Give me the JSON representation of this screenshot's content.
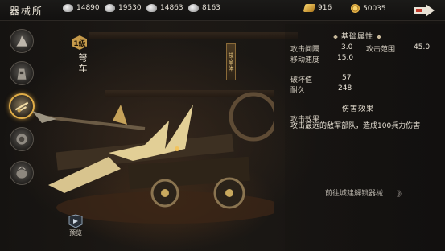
{
  "header": {
    "title": "器械所",
    "resources": [
      {
        "icon": "silver-ore-icon",
        "value": "14890"
      },
      {
        "icon": "iron-ore-icon",
        "value": "19530"
      },
      {
        "icon": "stone-icon",
        "value": "14863"
      },
      {
        "icon": "wood-icon",
        "value": "8163"
      }
    ],
    "currencies": [
      {
        "icon": "gold-ingot-icon",
        "value": "916"
      },
      {
        "icon": "coin-icon",
        "value": "50035"
      }
    ]
  },
  "unit": {
    "level": "1级",
    "name": "弩车",
    "tag": "技·单体"
  },
  "stats": {
    "section_title": "基础属性",
    "attack_interval_label": "攻击间隔",
    "attack_interval": "3.0",
    "attack_range_label": "攻击范围",
    "attack_range": "45.0",
    "move_speed_label": "移动速度",
    "move_speed": "15.0",
    "demolition_label": "破坏值",
    "demolition": "57",
    "durability_label": "耐久",
    "durability": "248"
  },
  "damage": {
    "section_title": "伤害效果",
    "effect_label": "攻击效果",
    "effect_text": "攻击最远的敌军部队，造成100兵力伤害"
  },
  "actions": {
    "goto_text": "前往城建解锁器械",
    "goto_arrows": "》》",
    "preview_label": "预览"
  },
  "colors": {
    "accent_gold": "#e0ad48",
    "panel_text": "#e6e0d4"
  }
}
